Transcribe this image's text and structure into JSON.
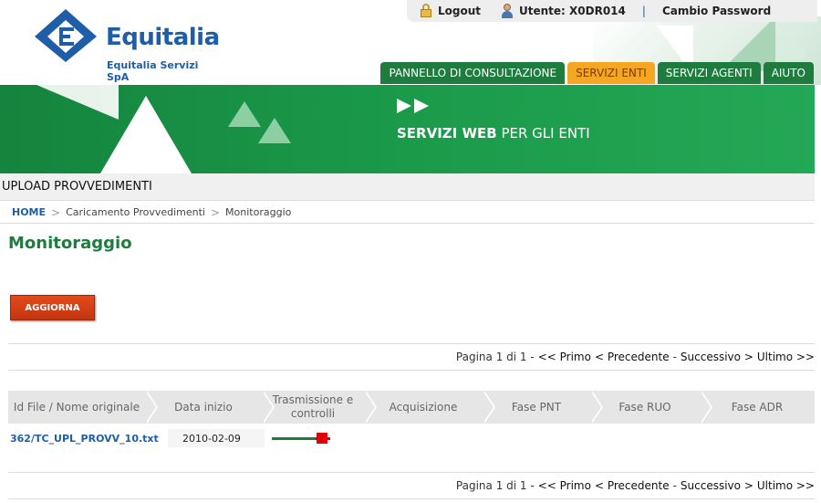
{
  "header": {
    "logout_label": "Logout",
    "user_label": "Utente: X0DR014",
    "separator": "|",
    "change_password_label": "Cambio Password",
    "logo_title": "Equitalia",
    "logo_subtitle": "Equitalia Servizi SpA"
  },
  "nav": {
    "tabs": [
      {
        "label": "PANNELLO DI CONSULTAZIONE",
        "active": false
      },
      {
        "label": "SERVIZI ENTI",
        "active": true
      },
      {
        "label": "SERVIZI AGENTI",
        "active": false
      },
      {
        "label": "AIUTO",
        "active": false
      }
    ]
  },
  "banner": {
    "title_bold": "SERVIZI WEB",
    "title_rest": " PER GLI ENTI"
  },
  "section": {
    "title": "UPLOAD PROVVEDIMENTI"
  },
  "breadcrumb": {
    "home": "HOME",
    "sep": ">",
    "level1": "Caricamento Provvedimenti",
    "level2": "Monitoraggio"
  },
  "page": {
    "title": "Monitoraggio",
    "refresh_button": "AGGIORNA"
  },
  "pager": {
    "info": "Pagina 1 di 1 - ",
    "first": "<< Primo",
    "prev": "< Precedente",
    "dash": "-",
    "next": "Successivo >",
    "last": "Ultimo >>"
  },
  "steps": [
    {
      "label": "Id File / Nome originale"
    },
    {
      "label": "Data inizio"
    },
    {
      "label": "Trasmissione e controlli"
    },
    {
      "label": "Acquisizione"
    },
    {
      "label": "Fase PNT"
    },
    {
      "label": "Fase RUO"
    },
    {
      "label": "Fase ADR"
    }
  ],
  "rows": [
    {
      "file": "362/TC_UPL_PROVV_10.txt",
      "date": "2010-02-09",
      "status": "error"
    }
  ],
  "colors": {
    "brand_blue": "#1e5ea8",
    "brand_green": "#1e7d3e",
    "active_tab": "#f5a623",
    "button_red": "#d43e15",
    "error_red": "#e00000"
  }
}
